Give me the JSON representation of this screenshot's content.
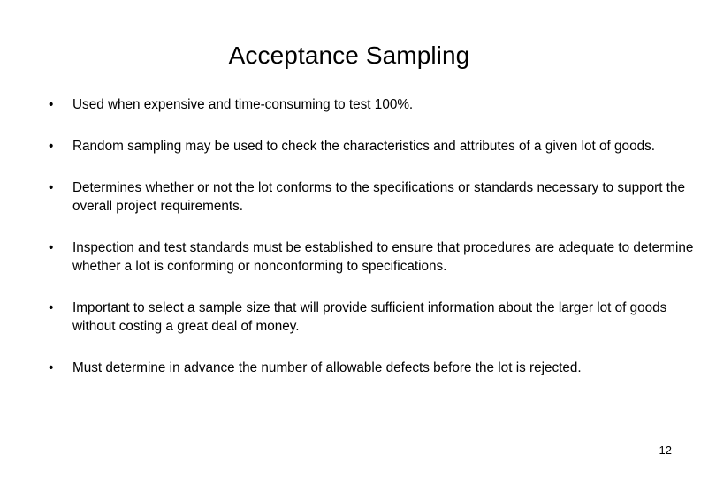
{
  "slide": {
    "title": "Acceptance Sampling",
    "page_number": "12",
    "bullet_marker": "•",
    "bullets": [
      {
        "text": "Used when expensive and time-consuming to test 100%."
      },
      {
        "text": "Random sampling may be used to check the characteristics and attributes of a given lot of goods."
      },
      {
        "text": "Determines whether or not the lot conforms to the specifications or standards necessary to support the overall project requirements."
      },
      {
        "text": "Inspection and test standards must be established to ensure that procedures are adequate to determine whether a lot is conforming or nonconforming to specifications."
      },
      {
        "text": "Important to select a sample size that will provide sufficient information about the larger lot of goods without costing a great deal of money."
      },
      {
        "text": "Must determine in advance the number of allowable defects before the lot is rejected."
      }
    ]
  },
  "colors": {
    "background": "#ffffff",
    "text": "#000000"
  }
}
